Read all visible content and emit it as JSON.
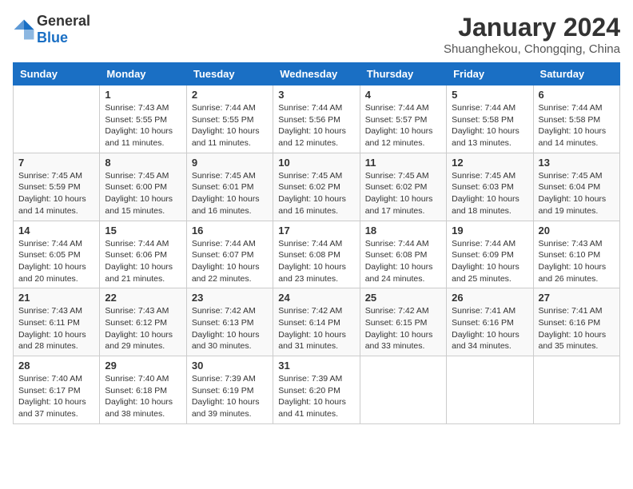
{
  "header": {
    "logo_general": "General",
    "logo_blue": "Blue",
    "month": "January 2024",
    "location": "Shuanghekou, Chongqing, China"
  },
  "weekdays": [
    "Sunday",
    "Monday",
    "Tuesday",
    "Wednesday",
    "Thursday",
    "Friday",
    "Saturday"
  ],
  "weeks": [
    [
      {
        "day": "",
        "info": ""
      },
      {
        "day": "1",
        "info": "Sunrise: 7:43 AM\nSunset: 5:55 PM\nDaylight: 10 hours and 11 minutes."
      },
      {
        "day": "2",
        "info": "Sunrise: 7:44 AM\nSunset: 5:55 PM\nDaylight: 10 hours and 11 minutes."
      },
      {
        "day": "3",
        "info": "Sunrise: 7:44 AM\nSunset: 5:56 PM\nDaylight: 10 hours and 12 minutes."
      },
      {
        "day": "4",
        "info": "Sunrise: 7:44 AM\nSunset: 5:57 PM\nDaylight: 10 hours and 12 minutes."
      },
      {
        "day": "5",
        "info": "Sunrise: 7:44 AM\nSunset: 5:58 PM\nDaylight: 10 hours and 13 minutes."
      },
      {
        "day": "6",
        "info": "Sunrise: 7:44 AM\nSunset: 5:58 PM\nDaylight: 10 hours and 14 minutes."
      }
    ],
    [
      {
        "day": "7",
        "info": "Sunrise: 7:45 AM\nSunset: 5:59 PM\nDaylight: 10 hours and 14 minutes."
      },
      {
        "day": "8",
        "info": "Sunrise: 7:45 AM\nSunset: 6:00 PM\nDaylight: 10 hours and 15 minutes."
      },
      {
        "day": "9",
        "info": "Sunrise: 7:45 AM\nSunset: 6:01 PM\nDaylight: 10 hours and 16 minutes."
      },
      {
        "day": "10",
        "info": "Sunrise: 7:45 AM\nSunset: 6:02 PM\nDaylight: 10 hours and 16 minutes."
      },
      {
        "day": "11",
        "info": "Sunrise: 7:45 AM\nSunset: 6:02 PM\nDaylight: 10 hours and 17 minutes."
      },
      {
        "day": "12",
        "info": "Sunrise: 7:45 AM\nSunset: 6:03 PM\nDaylight: 10 hours and 18 minutes."
      },
      {
        "day": "13",
        "info": "Sunrise: 7:45 AM\nSunset: 6:04 PM\nDaylight: 10 hours and 19 minutes."
      }
    ],
    [
      {
        "day": "14",
        "info": "Sunrise: 7:44 AM\nSunset: 6:05 PM\nDaylight: 10 hours and 20 minutes."
      },
      {
        "day": "15",
        "info": "Sunrise: 7:44 AM\nSunset: 6:06 PM\nDaylight: 10 hours and 21 minutes."
      },
      {
        "day": "16",
        "info": "Sunrise: 7:44 AM\nSunset: 6:07 PM\nDaylight: 10 hours and 22 minutes."
      },
      {
        "day": "17",
        "info": "Sunrise: 7:44 AM\nSunset: 6:08 PM\nDaylight: 10 hours and 23 minutes."
      },
      {
        "day": "18",
        "info": "Sunrise: 7:44 AM\nSunset: 6:08 PM\nDaylight: 10 hours and 24 minutes."
      },
      {
        "day": "19",
        "info": "Sunrise: 7:44 AM\nSunset: 6:09 PM\nDaylight: 10 hours and 25 minutes."
      },
      {
        "day": "20",
        "info": "Sunrise: 7:43 AM\nSunset: 6:10 PM\nDaylight: 10 hours and 26 minutes."
      }
    ],
    [
      {
        "day": "21",
        "info": "Sunrise: 7:43 AM\nSunset: 6:11 PM\nDaylight: 10 hours and 28 minutes."
      },
      {
        "day": "22",
        "info": "Sunrise: 7:43 AM\nSunset: 6:12 PM\nDaylight: 10 hours and 29 minutes."
      },
      {
        "day": "23",
        "info": "Sunrise: 7:42 AM\nSunset: 6:13 PM\nDaylight: 10 hours and 30 minutes."
      },
      {
        "day": "24",
        "info": "Sunrise: 7:42 AM\nSunset: 6:14 PM\nDaylight: 10 hours and 31 minutes."
      },
      {
        "day": "25",
        "info": "Sunrise: 7:42 AM\nSunset: 6:15 PM\nDaylight: 10 hours and 33 minutes."
      },
      {
        "day": "26",
        "info": "Sunrise: 7:41 AM\nSunset: 6:16 PM\nDaylight: 10 hours and 34 minutes."
      },
      {
        "day": "27",
        "info": "Sunrise: 7:41 AM\nSunset: 6:16 PM\nDaylight: 10 hours and 35 minutes."
      }
    ],
    [
      {
        "day": "28",
        "info": "Sunrise: 7:40 AM\nSunset: 6:17 PM\nDaylight: 10 hours and 37 minutes."
      },
      {
        "day": "29",
        "info": "Sunrise: 7:40 AM\nSunset: 6:18 PM\nDaylight: 10 hours and 38 minutes."
      },
      {
        "day": "30",
        "info": "Sunrise: 7:39 AM\nSunset: 6:19 PM\nDaylight: 10 hours and 39 minutes."
      },
      {
        "day": "31",
        "info": "Sunrise: 7:39 AM\nSunset: 6:20 PM\nDaylight: 10 hours and 41 minutes."
      },
      {
        "day": "",
        "info": ""
      },
      {
        "day": "",
        "info": ""
      },
      {
        "day": "",
        "info": ""
      }
    ]
  ]
}
